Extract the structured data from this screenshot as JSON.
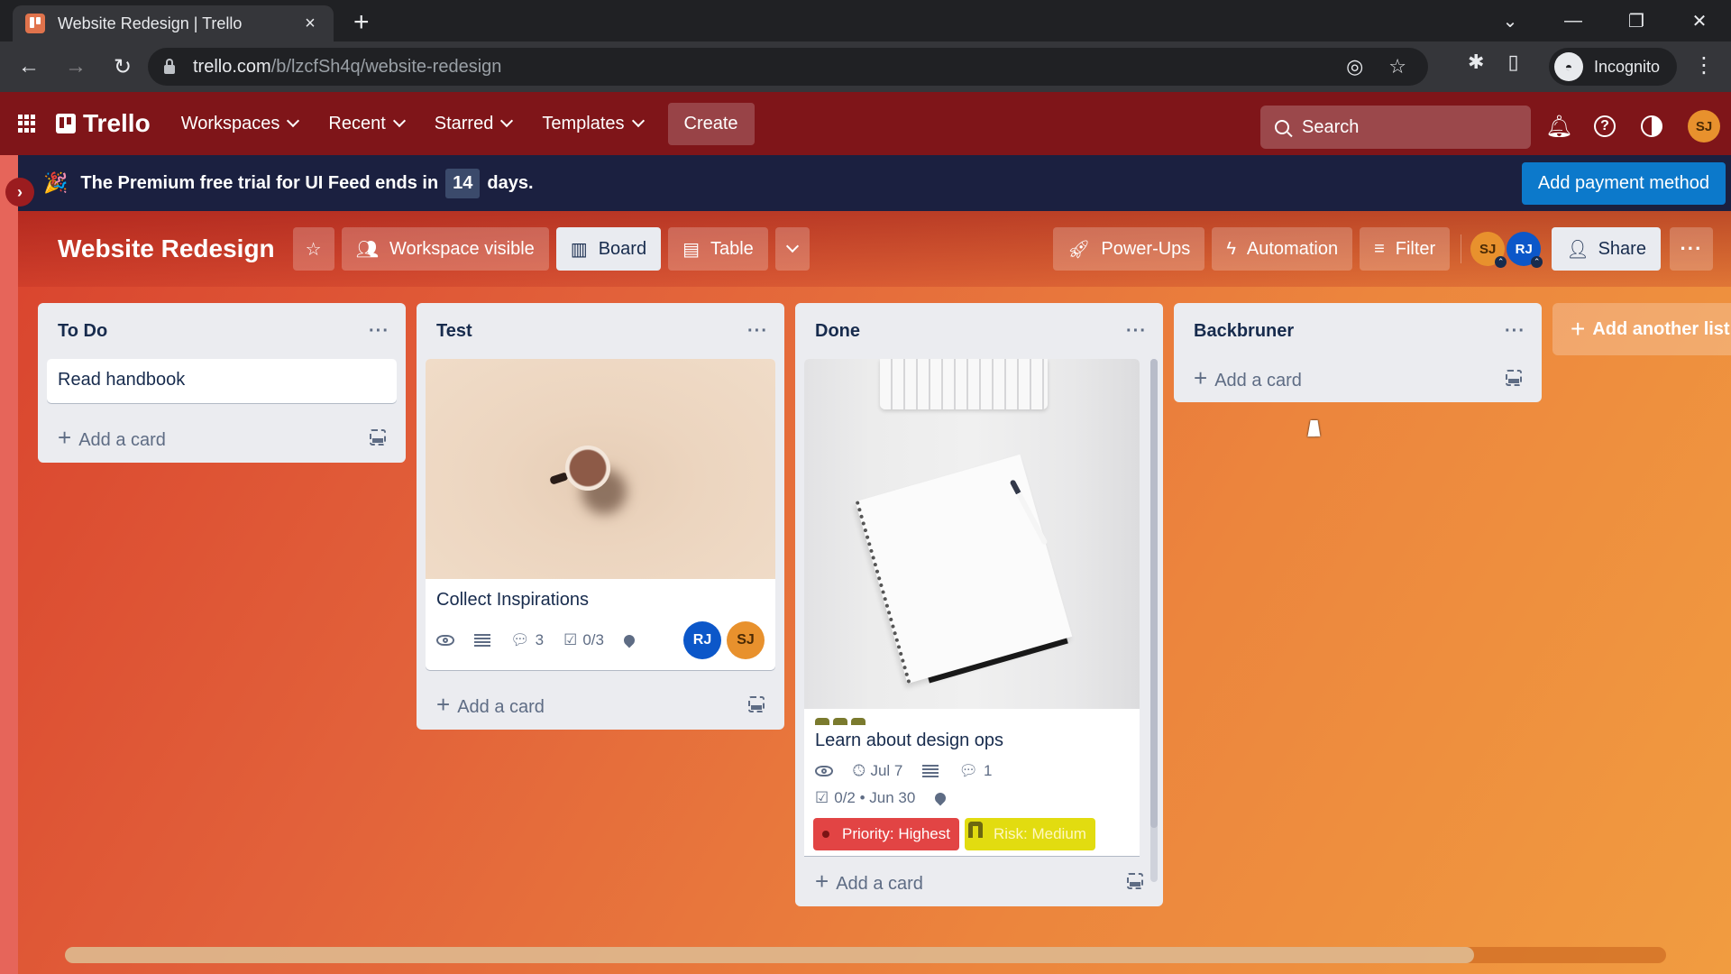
{
  "browser": {
    "tab_title": "Website Redesign | Trello",
    "url_host": "trello.com",
    "url_path": "/b/lzcfSh4q/website-redesign",
    "profile_label": "Incognito",
    "icons": {
      "back": "←",
      "forward": "→",
      "reload": "↻",
      "new_tab": "+",
      "close_tab": "×",
      "tab_search": "⌄",
      "minimize": "—",
      "restore": "❐",
      "close_window": "✕",
      "tracking": "◎",
      "bookmark": "☆",
      "extensions": "✱",
      "sidepanel": "▯",
      "menu": "⋮"
    }
  },
  "header": {
    "logo": "Trello",
    "nav": [
      {
        "label": "Workspaces"
      },
      {
        "label": "Recent"
      },
      {
        "label": "Starred"
      },
      {
        "label": "Templates"
      }
    ],
    "create_label": "Create",
    "search_placeholder": "Search",
    "icons": {
      "notifications": "🔔",
      "help": "?"
    },
    "user_initials": "SJ"
  },
  "banner": {
    "text_before": "The Premium free trial for UI Feed ends in",
    "days": "14",
    "text_after": "days.",
    "cta": "Add payment method",
    "party_icon": "🎉",
    "sidebar_toggle": "›"
  },
  "board": {
    "title": "Website Redesign",
    "star_icon": "☆",
    "visibility_label": "Workspace visible",
    "views": [
      {
        "label": "Board",
        "icon": "▥",
        "active": true
      },
      {
        "label": "Table",
        "icon": "▤",
        "active": false
      }
    ],
    "views_more_icon": "⌄",
    "powerups_label": "Power-Ups",
    "automation_label": "Automation",
    "filter_label": "Filter",
    "members": [
      {
        "initials": "SJ",
        "color": "#e8912d"
      },
      {
        "initials": "RJ",
        "color": "#0c57c9"
      }
    ],
    "share_label": "Share",
    "more_icon": "···",
    "add_list_label": "Add another list",
    "horizontal_scroll_fraction": 0.88
  },
  "lists": [
    {
      "title": "To Do",
      "cards": [
        {
          "title": "Read handbook"
        }
      ],
      "add_card_label": "Add a card"
    },
    {
      "title": "Test",
      "cards": [
        {
          "title": "Collect Inspirations",
          "cover": "coffee-cup-photo",
          "comments": "3",
          "checklist": "0/3",
          "members": [
            "RJ",
            "SJ"
          ]
        }
      ],
      "add_card_label": "Add a card"
    },
    {
      "title": "Done",
      "cards": [
        {
          "title": "Learn about design ops",
          "cover": "notebook-desk-photo",
          "due": "Jul 7",
          "comments": "1",
          "checklist": "0/2 • Jun 30",
          "labels": [
            {
              "text": "Priority: Highest",
              "color": "#e24444"
            },
            {
              "text": "Risk: Medium",
              "color": "#e2dc10"
            }
          ]
        }
      ],
      "add_card_label": "Add a card"
    },
    {
      "title": "Backbruner",
      "cards": [],
      "add_card_label": "Add a card"
    }
  ],
  "colors": {
    "header_bg": "#7f1519",
    "banner_bg": "#1b2040",
    "cta_blue": "#0c79cb",
    "list_bg": "#ebecf0"
  }
}
